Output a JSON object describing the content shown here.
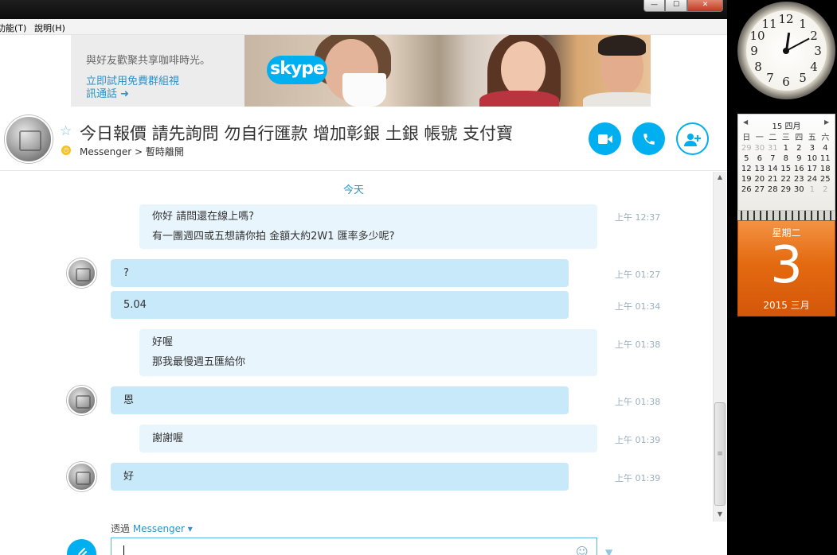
{
  "menubar": {
    "tools": "功能(T)",
    "help": "說明(H)"
  },
  "window_buttons": {
    "minimize": "—",
    "maximize": "☐",
    "close": "✕"
  },
  "ad": {
    "text": "與好友歡聚共享咖啡時光。",
    "link_line1": "立即試用免費群組視",
    "link_line2": "訊通話 ➜",
    "logo": "skype"
  },
  "contact": {
    "title": "今日報價 請先詢問 勿自行匯款 增加彰銀 土銀 帳號 支付寶",
    "status": "Messenger > 暫時離開"
  },
  "chat": {
    "day": "今天",
    "messages": [
      {
        "from": "me",
        "lines": [
          "你好 請問還在線上嗎?",
          "有一團週四或五想請你拍 金額大約2W1 匯率多少呢?"
        ],
        "time": "上午 12:37"
      },
      {
        "from": "them",
        "lines": [
          "?"
        ],
        "time": "上午 01:27"
      },
      {
        "from": "them",
        "lines": [
          "5.04"
        ],
        "time": "上午 01:34"
      },
      {
        "from": "me",
        "lines": [
          "好喔",
          "那我最慢週五匯給你"
        ],
        "time": "上午 01:38"
      },
      {
        "from": "them",
        "lines": [
          "恩"
        ],
        "time": "上午 01:38"
      },
      {
        "from": "me",
        "lines": [
          "謝謝喔"
        ],
        "time": "上午 01:39"
      },
      {
        "from": "them",
        "lines": [
          "好"
        ],
        "time": "上午 01:39"
      }
    ]
  },
  "compose": {
    "via_prefix": "透過 ",
    "via_link": "Messenger ▾"
  },
  "clock": {
    "numbers": [
      "12",
      "1",
      "2",
      "3",
      "4",
      "5",
      "6",
      "7",
      "8",
      "9",
      "10",
      "11"
    ]
  },
  "calendar": {
    "header": "15 四月",
    "weekdays": [
      "日",
      "一",
      "二",
      "三",
      "四",
      "五",
      "六"
    ],
    "days": [
      [
        "29",
        "30",
        "31",
        "1",
        "2",
        "3",
        "4"
      ],
      [
        "5",
        "6",
        "7",
        "8",
        "9",
        "10",
        "11"
      ],
      [
        "12",
        "13",
        "14",
        "15",
        "16",
        "17",
        "18"
      ],
      [
        "19",
        "20",
        "21",
        "22",
        "23",
        "24",
        "25"
      ],
      [
        "26",
        "27",
        "28",
        "29",
        "30",
        "1",
        "2"
      ]
    ]
  },
  "datecard": {
    "weekday": "星期二",
    "day": "3",
    "month": "2015 三月"
  },
  "colors": {
    "accent": "#00aff0",
    "bubble_them": "#c7e9f9",
    "bubble_me": "#e8f5fd",
    "link": "#2a93c9",
    "date_card": "#e46a10"
  }
}
